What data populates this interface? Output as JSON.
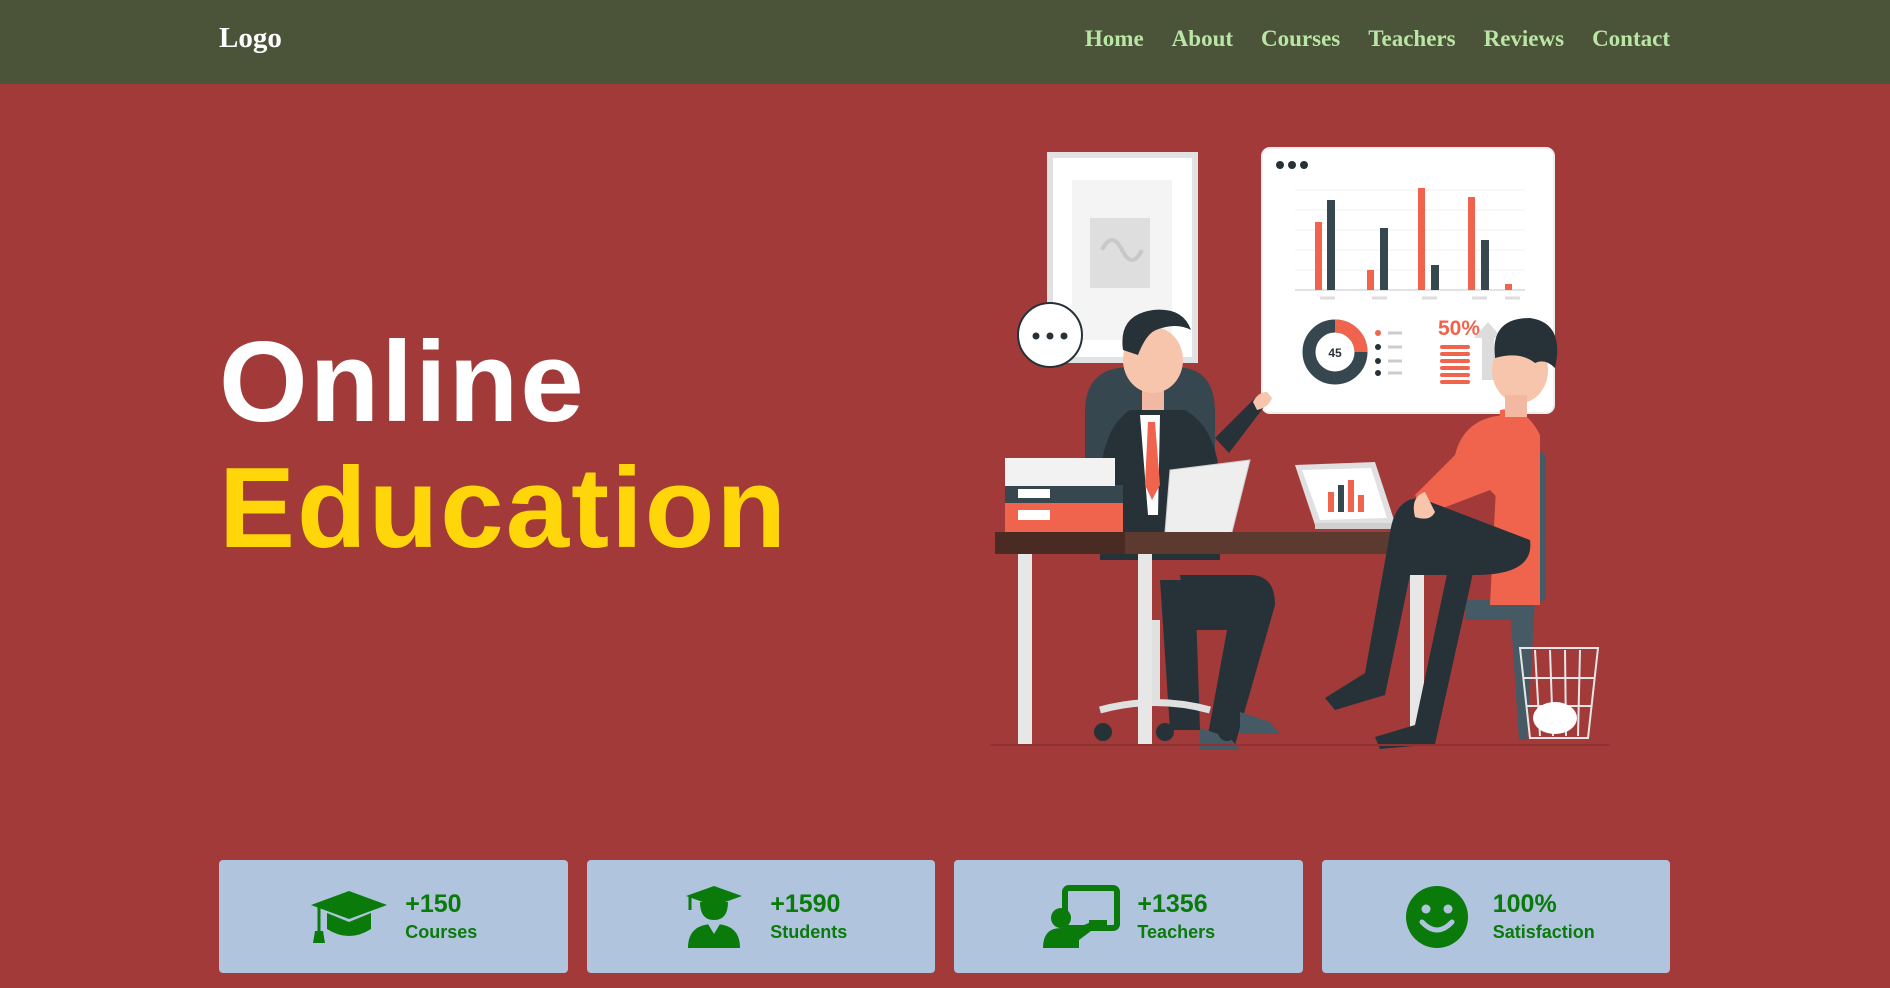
{
  "nav": {
    "logo": "Logo",
    "links": [
      "Home",
      "About",
      "Courses",
      "Teachers",
      "Reviews",
      "Contact"
    ]
  },
  "hero": {
    "title_line1": "Online",
    "title_line2": "Education"
  },
  "illustration": {
    "chart_percent": "50%",
    "donut_value": "45"
  },
  "stats": [
    {
      "value": "+150",
      "label": "Courses",
      "icon": "graduation-cap-icon"
    },
    {
      "value": "+1590",
      "label": "Students",
      "icon": "student-icon"
    },
    {
      "value": "+1356",
      "label": "Teachers",
      "icon": "teacher-board-icon"
    },
    {
      "value": "100%",
      "label": "Satisfaction",
      "icon": "smiley-face-icon"
    }
  ],
  "colors": {
    "navbar": "#4b5338",
    "background": "#a33a3a",
    "nav_link": "#b9e6a6",
    "title_white": "#ffffff",
    "title_yellow": "#ffd60a",
    "card": "#b0c4de",
    "card_text": "#0a7a0a"
  }
}
